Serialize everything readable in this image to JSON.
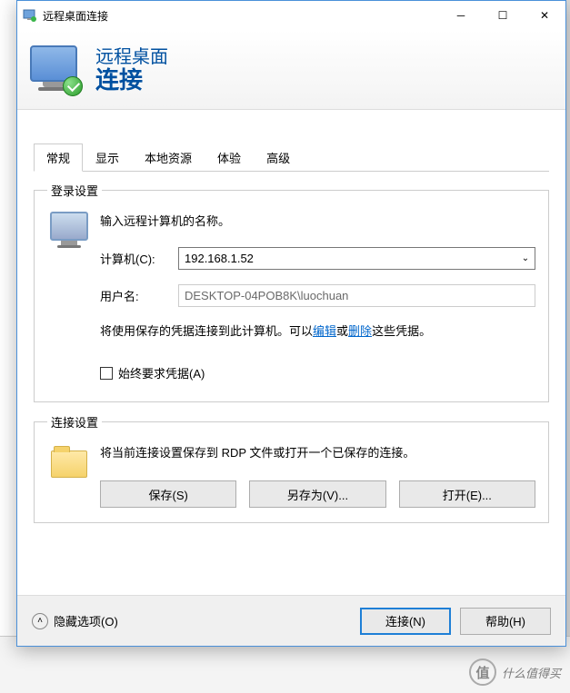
{
  "window": {
    "title": "远程桌面连接",
    "header_line1": "远程桌面",
    "header_line2": "连接"
  },
  "tabs": [
    "常规",
    "显示",
    "本地资源",
    "体验",
    "高级"
  ],
  "login": {
    "legend": "登录设置",
    "instruction": "输入远程计算机的名称。",
    "computer_label": "计算机(C):",
    "computer_value": "192.168.1.52",
    "username_label": "用户名:",
    "username_value": "DESKTOP-04POB8K\\luochuan",
    "note_pre": "将使用保存的凭据连接到此计算机。可以",
    "note_edit": "编辑",
    "note_or": "或",
    "note_delete": "删除",
    "note_post": "这些凭据。",
    "always_checkbox": "始终要求凭据(A)"
  },
  "conn": {
    "legend": "连接设置",
    "desc": "将当前连接设置保存到 RDP 文件或打开一个已保存的连接。",
    "save": "保存(S)",
    "saveas": "另存为(V)...",
    "open": "打开(E)..."
  },
  "footer": {
    "hide_options": "隐藏选项(O)",
    "connect": "连接(N)",
    "help": "帮助(H)"
  },
  "watermark": {
    "char": "值",
    "text": "什么值得买"
  }
}
